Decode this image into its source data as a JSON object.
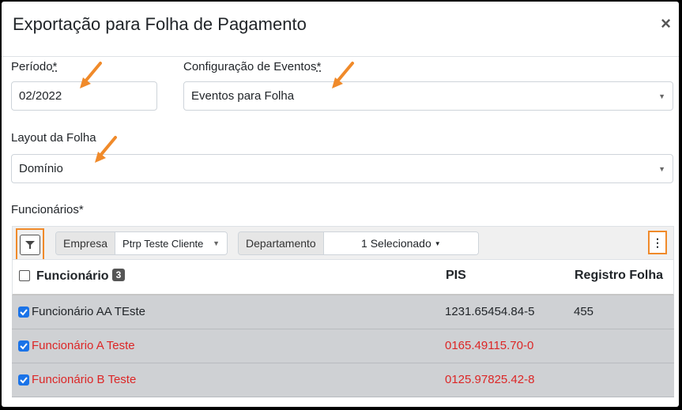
{
  "modal": {
    "title": "Exportação para Folha de Pagamento",
    "close": "×"
  },
  "periodo": {
    "label": "Período",
    "required": "*",
    "value": "02/2022"
  },
  "config": {
    "label": "Configuração de Eventos",
    "required": "*",
    "value": "Eventos para Folha"
  },
  "layout": {
    "label": "Layout da Folha",
    "value": "Domínio"
  },
  "funcionarios": {
    "label": "Funcionários*"
  },
  "toolbar": {
    "empresa_label": "Empresa",
    "empresa_value": "Ptrp Teste Cliente",
    "departamento_label": "Departamento",
    "departamento_value": "1 Selecionado",
    "menu": "⋮"
  },
  "table": {
    "headers": {
      "funcionario": "Funcionário",
      "count": "3",
      "pis": "PIS",
      "registro": "Registro Folha"
    },
    "rows": [
      {
        "name": "Funcionário AA TEste",
        "pis": "1231.65454.84-5",
        "registro": "455",
        "status": "normal"
      },
      {
        "name": "Funcionário A Teste",
        "pis": "0165.49115.70-0",
        "registro": "",
        "status": "error"
      },
      {
        "name": "Funcionário B Teste",
        "pis": "0125.97825.42-8",
        "registro": "",
        "status": "error"
      }
    ]
  },
  "colors": {
    "highlight": "#f08a2a",
    "checkbox": "#1a73e8",
    "error": "#dc2626",
    "row_bg": "#cfd1d4"
  },
  "icons": {
    "filter": "filter-icon",
    "caret": "caret-down-icon",
    "close": "close-icon",
    "arrow": "annotation-arrow-icon"
  }
}
